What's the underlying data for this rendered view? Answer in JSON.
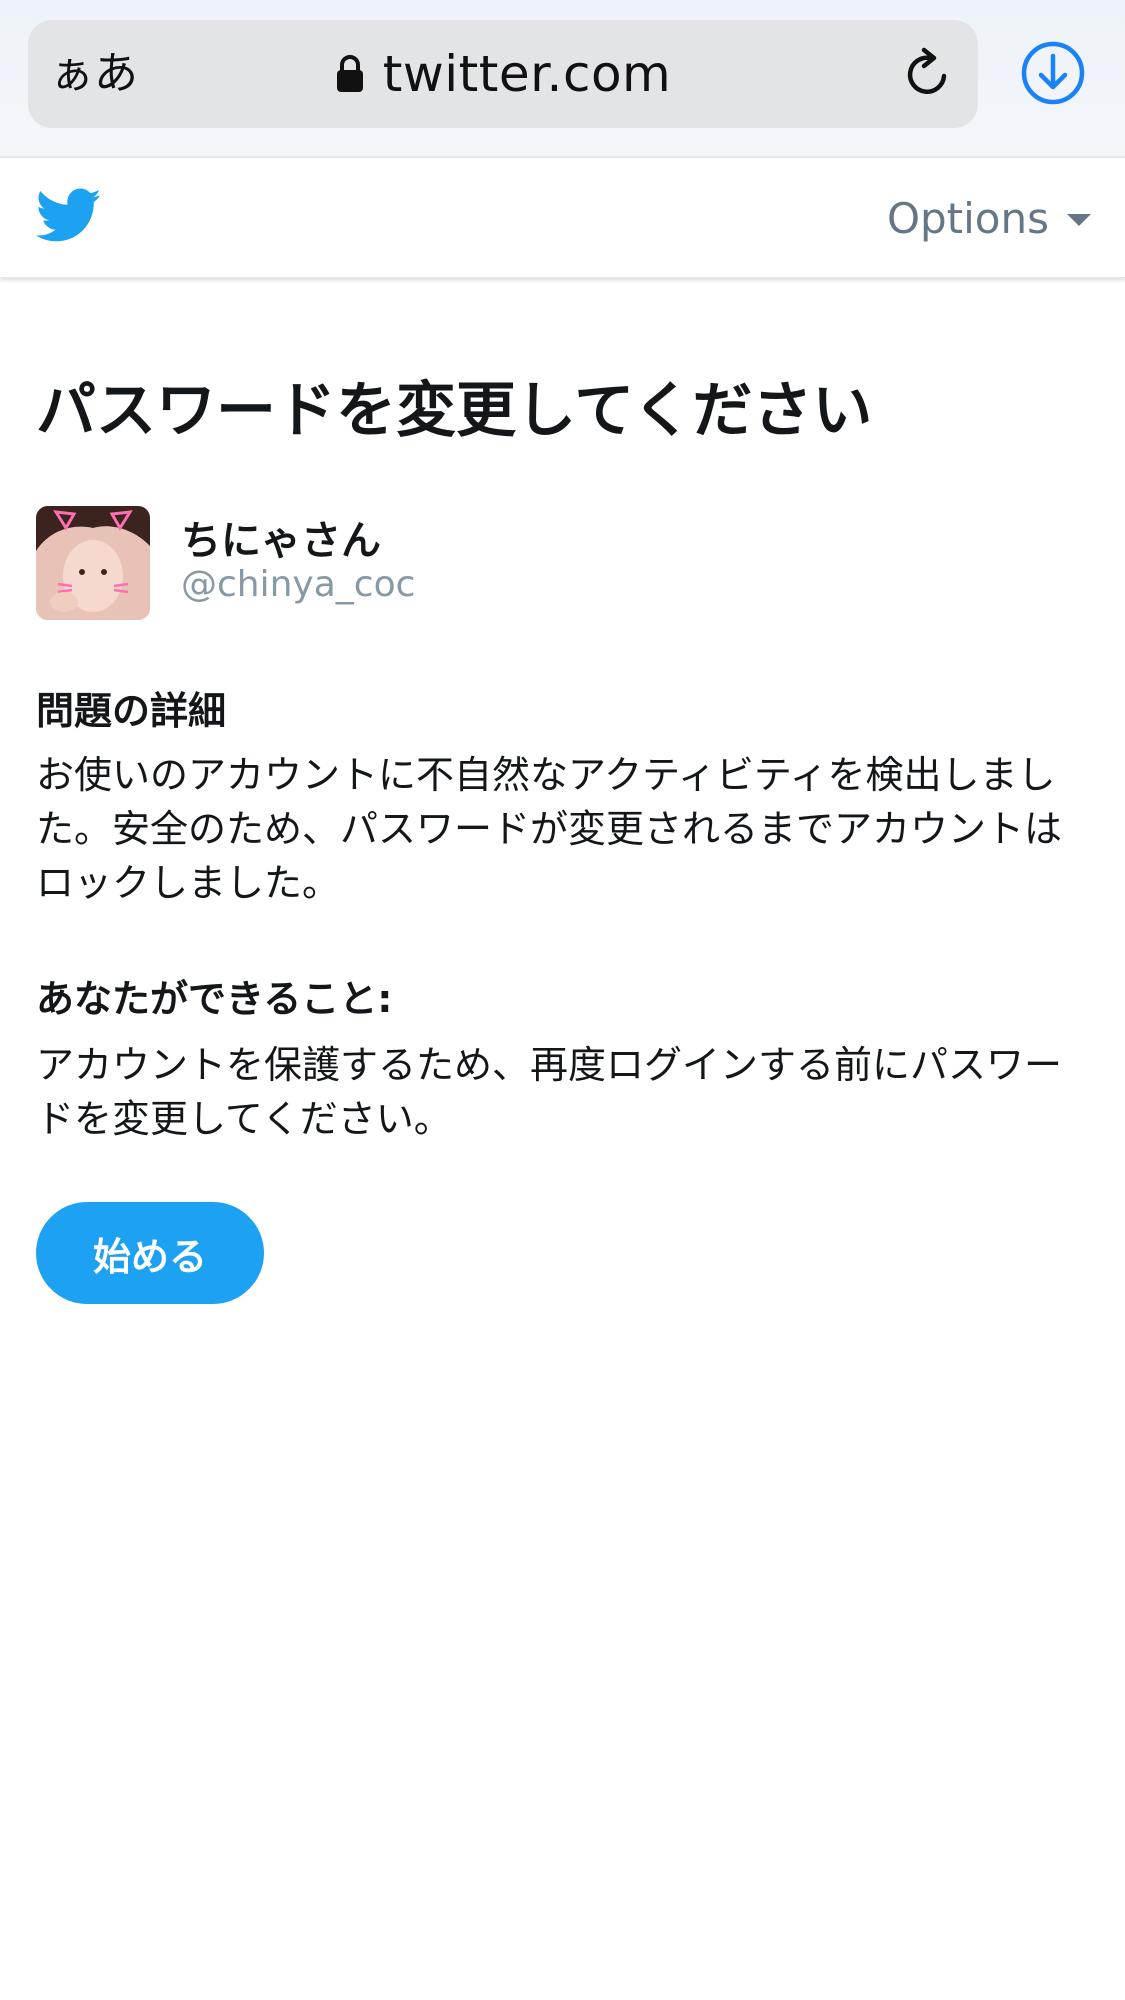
{
  "browser": {
    "text_size_label": "ぁあ",
    "domain": "twitter.com",
    "icons": [
      "lock-icon",
      "reload-icon",
      "download-icon"
    ],
    "accent_color": "#1a82f7"
  },
  "header": {
    "logo": "twitter-bird-icon",
    "options_label": "Options",
    "brand_color": "#1da1f2"
  },
  "main": {
    "title": "パスワードを変更してください",
    "user": {
      "display_name": "ちにゃさん",
      "handle": "@chinya_coc"
    },
    "problem": {
      "heading": "問題の詳細",
      "body": "お使いのアカウントに不自然なアクティビティを検出しました。安全のため、パスワードが変更されるまでアカウントはロックしました。"
    },
    "actions": {
      "heading": "あなたができること:",
      "body": "アカウントを保護するため、再度ログインする前にパスワードを変更してください。"
    },
    "start_button_label": "始める"
  }
}
